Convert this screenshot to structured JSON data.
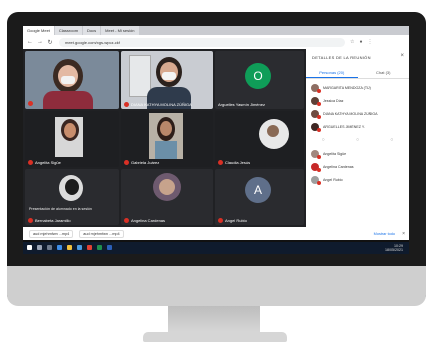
{
  "browser": {
    "tabs": [
      "Google Meet",
      "Classroom",
      "Docs",
      "Meet - Mi sesión",
      ""
    ],
    "url": "meet.google.com/xgs-wpcz-ckf"
  },
  "meeting": {
    "tiles": [
      {
        "name": "",
        "kind": "video"
      },
      {
        "name": "DIANA KATHYA MOLINA ZÚÑIGA",
        "kind": "video"
      },
      {
        "name": "Arguelles Yasmín Jiménez",
        "kind": "avatar",
        "initial": "O",
        "color": "#0f9d58"
      },
      {
        "name": "Angelita Sigüe",
        "kind": "video"
      },
      {
        "name": "Gabriela Juárez",
        "kind": "video"
      },
      {
        "name": "Claudia Jesús",
        "kind": "video"
      },
      {
        "name": "Bernabeta Jaramillo",
        "kind": "video"
      },
      {
        "name": "Angelina Cardenas",
        "kind": "video"
      },
      {
        "name": "Angel Rubio",
        "kind": "avatar",
        "initial": "A",
        "color": "#5f6f8a"
      }
    ],
    "overlay_caption": "Presentación de alumnado en la sesión"
  },
  "side_panel": {
    "title": "DETALLES DE LA REUNIÓN",
    "tabs": [
      "Personas (20)",
      "Chat (3)"
    ],
    "people": [
      {
        "name": "MARGARITA MENDOZA (TÚ)",
        "color": "#8d6e63"
      },
      {
        "name": "Jessica Díaz",
        "color": "#5d4037"
      },
      {
        "name": "DIANA KATHYA MOLINA ZÚÑIGA",
        "color": "#6d4c41"
      },
      {
        "name": "ARGUELLES JIMÉNEZ Y.",
        "color": "#3e2723"
      },
      {
        "name": "Angelita Sigüe",
        "color": "#a1887f"
      },
      {
        "name": "Angelina Cardenas",
        "color": "#c62828"
      },
      {
        "name": "Angel Rubio",
        "color": "#9e9e9e"
      }
    ]
  },
  "downloads": {
    "items": [
      "aud mjehmfwn ...mp4",
      "aud mjehmfwn ...mp4"
    ],
    "show_all": "Mostrar todo"
  },
  "taskbar": {
    "time": "10:29",
    "date": "18/05/2021"
  }
}
